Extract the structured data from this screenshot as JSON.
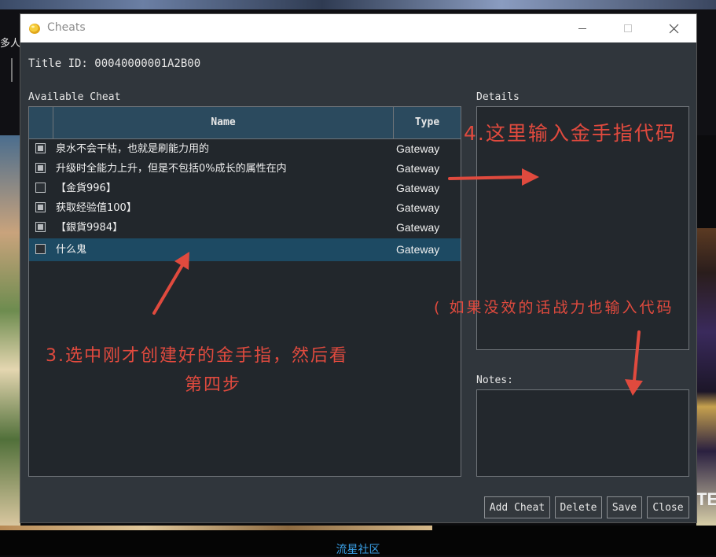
{
  "background": {
    "left_text": "多人",
    "corner_text": "TE",
    "footer_text": "流星社区"
  },
  "window": {
    "title": "Cheats",
    "icon": "coin-icon",
    "controls": [
      "minimize-icon",
      "maximize-icon",
      "close-icon"
    ]
  },
  "title_id": "Title ID: 00040000001A2B00",
  "available_label": "Available Cheat",
  "details_label": "Details",
  "notes_label": "Notes:",
  "table": {
    "columns": [
      "Name",
      "Type"
    ],
    "rows": [
      {
        "checked": true,
        "name": "泉水不会干枯，也就是刷能力用的",
        "type": "Gateway"
      },
      {
        "checked": true,
        "name": "升级时全能力上升，但是不包括0%成长的属性在内",
        "type": "Gateway"
      },
      {
        "checked": false,
        "name": "【金貨996】",
        "type": "Gateway"
      },
      {
        "checked": true,
        "name": "获取经验值100】",
        "type": "Gateway"
      },
      {
        "checked": true,
        "name": "【銀貨9984】",
        "type": "Gateway"
      },
      {
        "checked": false,
        "name": "什么鬼",
        "type": "Gateway",
        "selected": true
      }
    ]
  },
  "buttons": {
    "add": "Add Cheat",
    "delete": "Delete",
    "save": "Save",
    "close": "Close"
  },
  "annotations": {
    "step4": "4.这里输入金手指代码",
    "hint": "( 如果没效的话战力也输入代码",
    "step3_line1": "3.选中刚才创建好的金手指，然后看",
    "step3_line2": "第四步"
  },
  "colors": {
    "dialog_bg": "#30363c",
    "header_bg": "#2b4a5e",
    "selected_row": "#1d4a63",
    "annotation": "#e04a3e",
    "footer_link": "#3aa0e6"
  }
}
